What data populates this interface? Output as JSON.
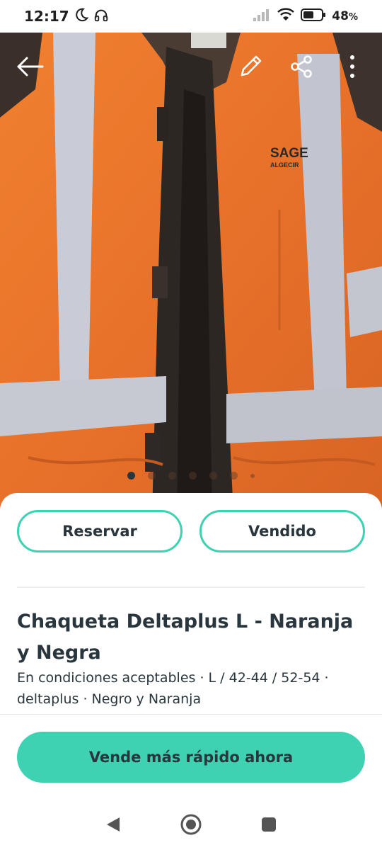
{
  "status": {
    "time": "12:17",
    "battery": "48",
    "battery_unit": "%"
  },
  "gallery": {
    "image_count": 7,
    "active_index": 0
  },
  "actions": {
    "reserve_label": "Reservar",
    "sold_label": "Vendido"
  },
  "product": {
    "title": "Chaqueta Deltaplus L - Naranja y Negra",
    "details": "En condiciones aceptables · L / 42-44 / 52-54 · deltaplus · Negro y Naranja",
    "jacket_print_line1": "SAGE",
    "jacket_print_line2": "ALGECIR"
  },
  "cta": {
    "label": "Vende más rápido ahora"
  },
  "colors": {
    "accent": "#3ed1b2",
    "text": "#29363d",
    "jacket_orange": "#e8742a"
  },
  "icons": {
    "back": "arrow-left-icon",
    "edit": "pencil-icon",
    "share": "share-icon",
    "more": "more-vertical-icon"
  }
}
